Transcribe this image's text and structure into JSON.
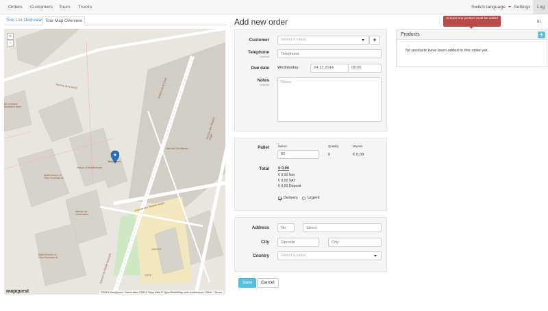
{
  "nav": {
    "items": [
      "Orders",
      "Customers",
      "Tours",
      "Trucks"
    ],
    "switch_language": "Switch language",
    "settings": "Settings",
    "login": "Log in"
  },
  "map_panel": {
    "tabs": [
      "Tour List Overview",
      "Tour Map Overview"
    ],
    "zoom_in": "+",
    "zoom_out": "-",
    "logo": "mapquest",
    "attribution": "©2014 MapQuest · Some data ©2014 *Map data © OpenStreetMap and contributors, ODbL · Terms",
    "labels": {
      "street_1": "Avenue de la Forêt",
      "street_2": "Avenue de la Forêt",
      "street_3": "Avenue des Sixteen-vingts",
      "street_4": "Avenue des Sixteen-vingts",
      "street_5": "Avenue de l'Etelle-Durande",
      "bank": "BC Investor Investors Bank",
      "poi_1": "Hall des Souffleries",
      "poi_2": "House of BioMedicine",
      "poi_3": "Bâtid fumeux & Fibul foumeau Bi",
      "poi_4": "Maison de l'Innovation",
      "poi_5": "Bâtid fumeux A / Fibul foumeau Al",
      "poi_6": "SANTEC",
      "poi_7": "CRTE",
      "marker_label": "Technoport"
    }
  },
  "form": {
    "title": "Add new order",
    "customer": {
      "label": "Customer",
      "placeholder": "Select a value",
      "add": "+"
    },
    "telephone": {
      "label": "Telephone",
      "optional": "Optional",
      "placeholder": "Telephone"
    },
    "due_date": {
      "label": "Due date",
      "weekday": "Wednesday",
      "date": "24.12.2014",
      "time": "08:00"
    },
    "notes": {
      "label": "Notes",
      "optional": "Optional",
      "placeholder": "Notes"
    },
    "pallet": {
      "label": "Pallet",
      "col_deliver": "Deliver",
      "col_quantity": "Quantity",
      "col_deposit": "Deposit",
      "value": "80",
      "quantity": "0",
      "deposit": "€ 0,00"
    },
    "total": {
      "label": "Total",
      "value": "€ 0,00",
      "net": "€ 0,00 Net",
      "vat": "€ 0,00 VAT",
      "deposit": "€ 0,00 Deposit"
    },
    "delivery_label": "Delivery",
    "urgent_label": "Urgent",
    "address": {
      "label": "Address",
      "no_placeholder": "No.",
      "street_placeholder": "Street"
    },
    "city": {
      "label": "City",
      "zip_placeholder": "Zipcode",
      "city_placeholder": "City"
    },
    "country": {
      "label": "Country",
      "placeholder": "Select a value"
    },
    "save": "Save",
    "cancel": "Cancel"
  },
  "products": {
    "title": "Products",
    "add": "+",
    "empty": "No products have been added to this order yet.",
    "tooltip": "At least one product must be added"
  }
}
